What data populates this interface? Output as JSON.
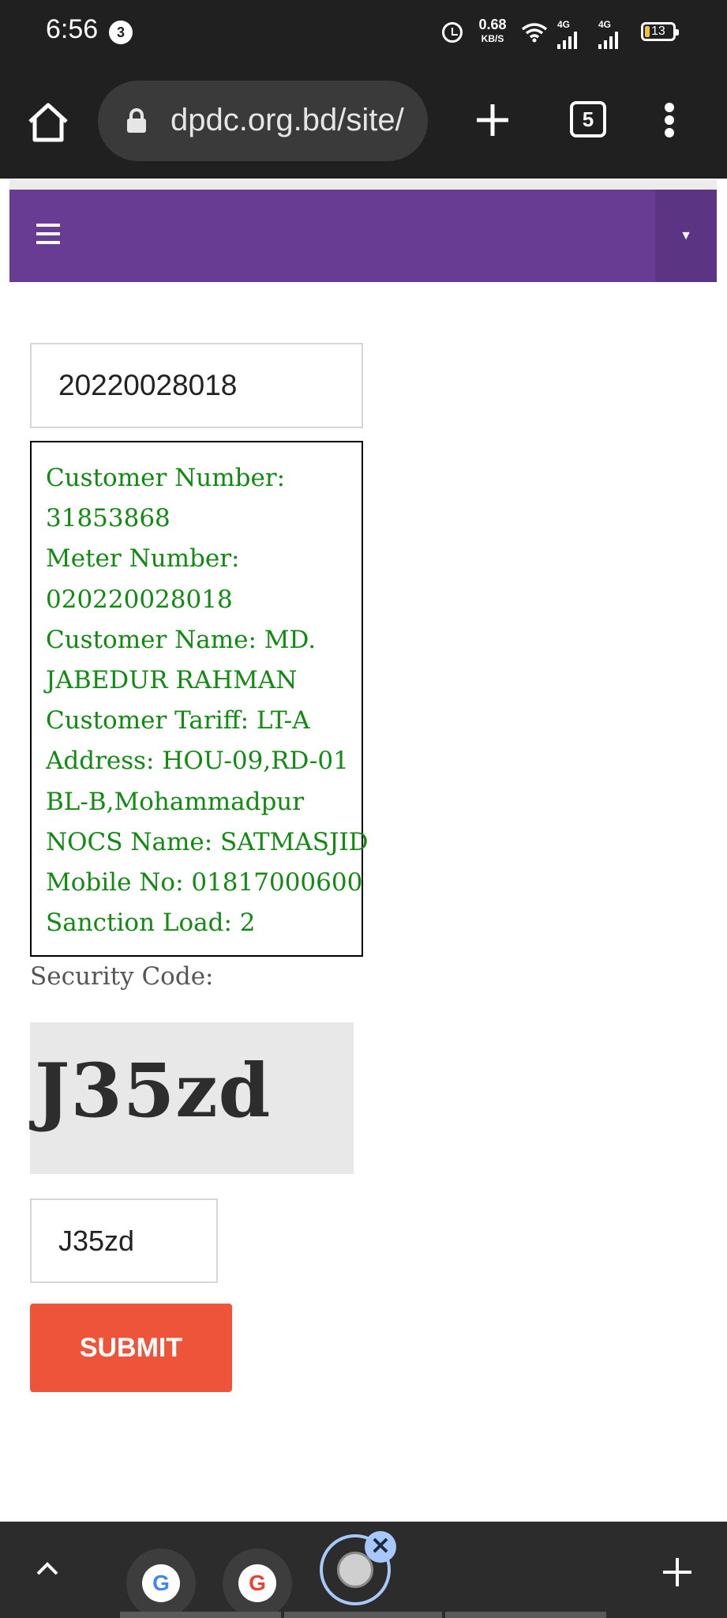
{
  "status_bar": {
    "time": "6:56",
    "notification_count": "3",
    "net_speed_value": "0.68",
    "net_speed_unit": "KB/S",
    "signal1_label": "4G",
    "signal2_label": "4G",
    "battery_level": "13"
  },
  "browser": {
    "url": "dpdc.org.bd/site/",
    "tab_count": "5"
  },
  "nav": {
    "dropdown_glyph": "▼"
  },
  "form": {
    "meter_input_value": "20220028018",
    "customer_info": [
      "Customer Number:",
      "31853868",
      "Meter Number:",
      "020220028018",
      "Customer Name: MD.",
      "JABEDUR RAHMAN",
      "Customer Tariff: LT-A",
      "Address: HOU-09,RD-01",
      "BL-B,Mohammadpur",
      "NOCS Name: SATMASJID",
      "Mobile No: 01817000600",
      "Sanction Load: 2"
    ],
    "security_label": "Security Code:",
    "captcha_text": "J35zd",
    "captcha_input_value": "J35zd",
    "submit_label": "SUBMIT"
  },
  "tab_strip": {
    "tab1_letter": "G",
    "tab2_letter": "G",
    "close_glyph": "✕"
  },
  "colors": {
    "nav_bg": "#673c92",
    "info_text": "#118a11",
    "submit_bg": "#ed543a"
  }
}
